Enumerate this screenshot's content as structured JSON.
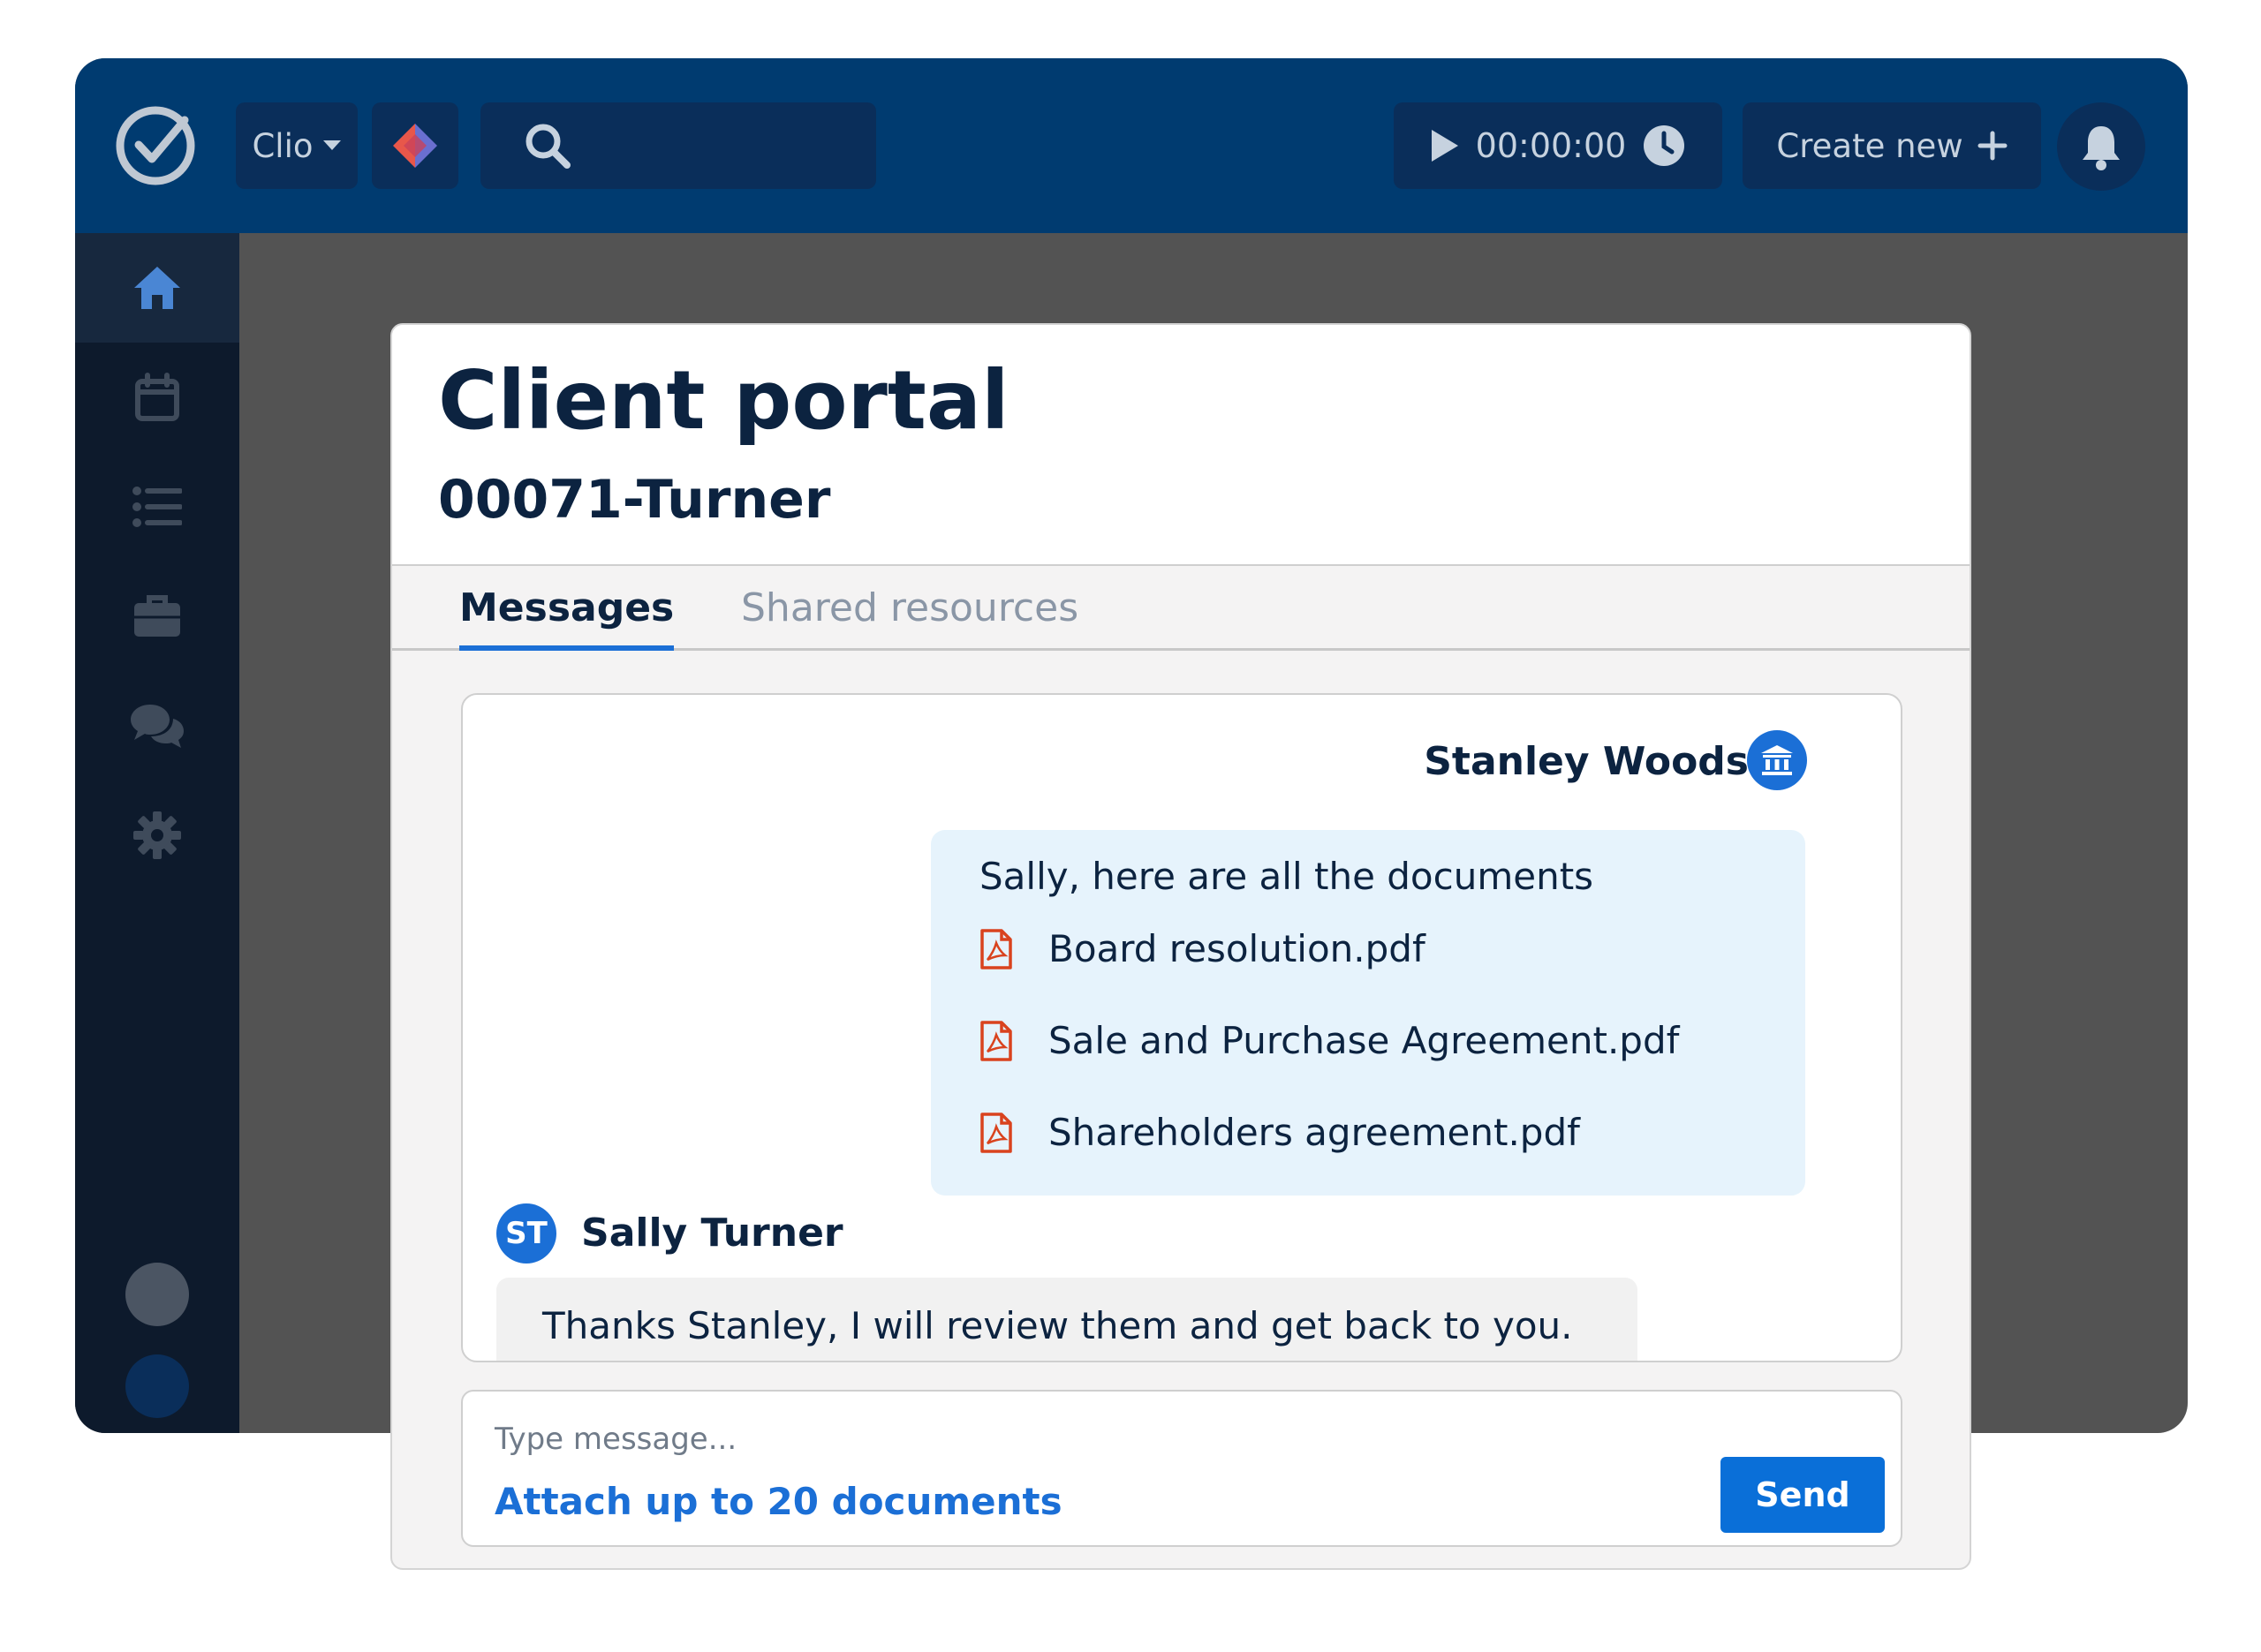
{
  "topbar": {
    "app_switcher_label": "Clio",
    "timer_value": "00:00:00",
    "create_new_label": "Create new"
  },
  "sidebar": {
    "items": [
      {
        "icon": "home-icon"
      },
      {
        "icon": "calendar-icon"
      },
      {
        "icon": "list-icon"
      },
      {
        "icon": "briefcase-icon"
      },
      {
        "icon": "chat-bubbles-icon"
      },
      {
        "icon": "gear-icon"
      }
    ]
  },
  "portal": {
    "title": "Client portal",
    "matter": "00071-Turner",
    "tabs": [
      "Messages",
      "Shared resources"
    ],
    "active_tab": "Messages"
  },
  "thread": {
    "outgoing": {
      "sender": "Stanley Woods",
      "text": "Sally, here are all the documents",
      "documents": [
        "Board resolution.pdf",
        "Sale and Purchase Agreement.pdf",
        "Shareholders agreement.pdf"
      ]
    },
    "incoming": {
      "sender": "Sally Turner",
      "initials": "ST",
      "text": "Thanks Stanley, I will review them and get back to you."
    }
  },
  "composer": {
    "placeholder": "Type message...",
    "attach_label": "Attach up to 20 documents",
    "send_label": "Send"
  },
  "colors": {
    "topbar": "#003b70",
    "sidebar": "#0d1a2c",
    "accent": "#1b6fd6",
    "pdf_icon": "#d9431e",
    "heading": "#0c2340"
  }
}
